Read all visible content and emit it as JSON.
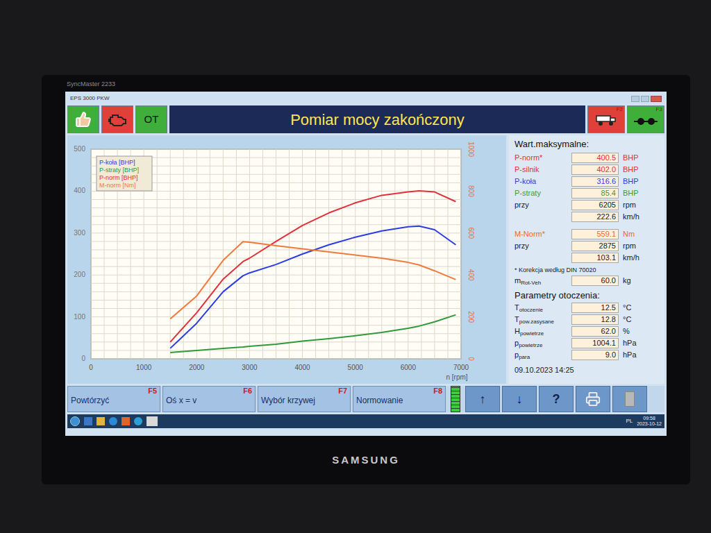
{
  "monitor": {
    "model": "SyncMaster 2233",
    "brand": "SAMSUNG"
  },
  "window": {
    "title": "EPS 3000 PKW"
  },
  "toolbar": {
    "left_buttons": [
      {
        "kind": "thumbs",
        "label": "",
        "color": "#3fae3a"
      },
      {
        "kind": "engine",
        "label": "",
        "color": "#e0403a"
      },
      {
        "kind": "text",
        "label": "OT",
        "color": "#3fae3a"
      }
    ],
    "title": "Pomiar mocy zakończony",
    "right_buttons": [
      {
        "kind": "dyno",
        "key": "F2",
        "color": "#e0403a"
      },
      {
        "kind": "axles",
        "key": "F3",
        "color": "#3fae3a"
      }
    ]
  },
  "chart": {
    "y_left_ticks": [
      "0",
      "100",
      "200",
      "300",
      "400",
      "500"
    ],
    "y_right_ticks": [
      "0",
      "200",
      "400",
      "600",
      "800",
      "1000"
    ],
    "x_ticks": [
      "0",
      "1000",
      "2000",
      "3000",
      "4000",
      "5000",
      "6000",
      "7000"
    ],
    "x_label": "n [rpm]",
    "rpm": [
      1500,
      2000,
      2500,
      2875,
      3000,
      3500,
      4000,
      4500,
      5000,
      5500,
      6000,
      6205,
      6500,
      6900
    ],
    "series": [
      {
        "name": "P-koła [BHP]",
        "color": "#2a3ee0",
        "axis": "left",
        "values": [
          25,
          85,
          160,
          198,
          205,
          225,
          250,
          272,
          290,
          305,
          315,
          316.6,
          308,
          272
        ]
      },
      {
        "name": "P-straty [BHP]",
        "color": "#2e9a3a",
        "axis": "left",
        "values": [
          15,
          20,
          25,
          28,
          30,
          35,
          42,
          48,
          55,
          63,
          73,
          78,
          88,
          105
        ]
      },
      {
        "name": "P-norm [BHP]",
        "color": "#e0303a",
        "axis": "left",
        "values": [
          40,
          110,
          190,
          232,
          240,
          280,
          318,
          348,
          372,
          390,
          398,
          400.5,
          398,
          375
        ]
      },
      {
        "name": "M-norm [Nm]",
        "color": "#f07a3c",
        "axis": "right",
        "values": [
          190,
          300,
          470,
          559.1,
          556,
          540,
          525,
          510,
          495,
          480,
          460,
          448,
          420,
          378
        ]
      }
    ]
  },
  "maxima": {
    "heading": "Wart.maksymalne:",
    "rows": [
      {
        "label": "P-norm*",
        "value": "400.5",
        "unit": "BHP",
        "color": "#e0303a"
      },
      {
        "label": "P-silnik",
        "value": "402.0",
        "unit": "BHP",
        "color": "#e0303a"
      },
      {
        "label": "P-koła",
        "value": "316.6",
        "unit": "BHP",
        "color": "#2a3ee0"
      },
      {
        "label": "P-straty",
        "value": "85.4",
        "unit": "BHP",
        "color": "#3c9a3c"
      },
      {
        "label": "przy",
        "value": "6205",
        "unit": "rpm",
        "color": "#1a1a1a"
      },
      {
        "label": "",
        "value": "222.6",
        "unit": "km/h",
        "color": "#1a1a1a"
      },
      {
        "label": "M-Norm*",
        "value": "559.1",
        "unit": "Nm",
        "color": "#ef6a2a"
      },
      {
        "label": "przy",
        "value": "2875",
        "unit": "rpm",
        "color": "#1a1a1a"
      },
      {
        "label": "",
        "value": "103.1",
        "unit": "km/h",
        "color": "#1a1a1a"
      }
    ],
    "note": "* Korekcja według DIN 70020",
    "mass": {
      "label": "m",
      "sub": "Rot-Veh",
      "value": "60.0",
      "unit": "kg"
    }
  },
  "environment": {
    "heading": "Parametry otoczenia:",
    "rows": [
      {
        "label": "T",
        "sub": "otoczenie",
        "value": "12.5",
        "unit": "°C"
      },
      {
        "label": "T",
        "sub": "pow.zasysane",
        "value": "12.8",
        "unit": "°C"
      },
      {
        "label": "H",
        "sub": "powietrze",
        "value": "62.0",
        "unit": "%"
      },
      {
        "label": "p",
        "sub": "powietrze",
        "value": "1004.1",
        "unit": "hPa"
      },
      {
        "label": "p",
        "sub": "para",
        "value": "9.0",
        "unit": "hPa"
      }
    ]
  },
  "date": "09.10.2023 14:25",
  "function_keys": [
    {
      "label": "Powtórzyć",
      "key": "F5"
    },
    {
      "label": "Oś x = v",
      "key": "F6"
    },
    {
      "label": "Wybór krzywej",
      "key": "F7"
    },
    {
      "label": "Normowanie",
      "key": "F8"
    }
  ],
  "meter": {
    "level": 1
  },
  "icon_buttons": [
    {
      "kind": "text",
      "label": "↑"
    },
    {
      "kind": "text",
      "label": "↓"
    },
    {
      "kind": "text",
      "label": "?"
    },
    {
      "kind": "printer",
      "label": ""
    },
    {
      "kind": "blank",
      "label": ""
    }
  ],
  "taskbar": {
    "language": "PL",
    "time": "09:58",
    "date": "2023-10-12"
  }
}
